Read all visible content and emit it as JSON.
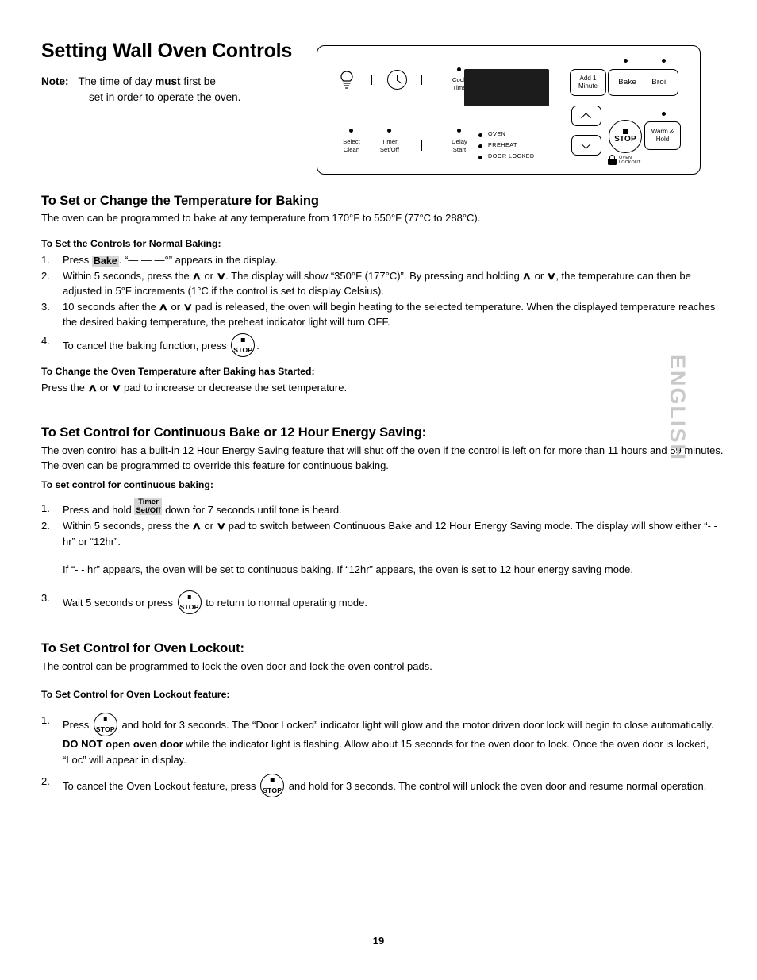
{
  "document": {
    "title": "Setting Wall Oven Controls",
    "page_number": "19",
    "side_tab": "ENGLISH"
  },
  "note": {
    "label": "Note:",
    "line1_part1": "The time of day ",
    "line1_bold": "must",
    "line1_part2": " first be",
    "line2": "set in order to operate the oven."
  },
  "control_panel": {
    "left_group": {
      "bulb_icon": "light-bulb-icon",
      "clock_icon": "clock-icon",
      "cook_time": "Cook\nTime",
      "select_clean": "Select\nClean",
      "timer_set_off": "Timer\nSet/Off",
      "delay_start": "Delay\nStart"
    },
    "indicators": [
      "OVEN",
      "PREHEAT",
      "DOOR LOCKED"
    ],
    "right_group": {
      "add_1_minute": "Add 1\nMinute",
      "bake": "Bake",
      "broil": "Broil",
      "up_arrow": "chevron-up-icon",
      "down_arrow": "chevron-down-icon",
      "stop": "STOP",
      "warm_hold": "Warm &\nHold",
      "oven_lockout": "OVEN\nLOCKOUT"
    }
  },
  "section_baking": {
    "title": "To Set or Change the Temperature for Baking",
    "intro": "The oven can be programmed to bake at any temperature from 170°F to 550°F (77°C to 288°C).",
    "sub_title": "To Set the Controls for Normal Baking:",
    "step1_pre": "Press ",
    "step1_key": "Bake",
    "step1_post": ". “— — —°” appears in the display.",
    "step2_a": "Within 5 seconds, press the ",
    "step2_b": " or ",
    "step2_c": ". The display will show “350°F (177°C)”. By pressing and holding ",
    "step2_d": " or ",
    "step2_e": ", the temperature can then be adjusted in 5°F increments (1°C if the control is set to display Celsius).",
    "step3_a": "10 seconds after the ",
    "step3_b": " or ",
    "step3_c": " pad is released, the oven will begin heating to the selected temperature. When the displayed temperature reaches the desired baking temperature, the preheat indicator light will turn OFF.",
    "step4_pre": "To cancel the baking function, press ",
    "step4_post": ".",
    "change_sub_title": "To Change the Oven Temperature after Baking has Started:",
    "change_a": "Press the ",
    "change_b": " or ",
    "change_c": " pad to increase or decrease the set temperature."
  },
  "section_continuous": {
    "title": "To Set Control for Continuous Bake or 12 Hour Energy Saving:",
    "intro": "The oven control has a built-in 12 Hour Energy Saving feature that will shut off the oven if the control is left on for more than 11 hours and 59 minutes. The oven can be programmed to override this feature for continuous baking.",
    "sub_title": "To set control for continuous baking:",
    "step1_pre": "Press and hold ",
    "step1_key": "Timer\nSet/Off",
    "step1_post": " down for 7 seconds until tone is heard.",
    "step2_a": "Within 5 seconds, press the ",
    "step2_b": " or ",
    "step2_c": " pad to switch between Continuous Bake and 12 Hour Energy Saving mode. The display will show either “- - hr” or “12hr”.",
    "step2_note": "If “- - hr” appears, the oven will be set to continuous baking. If “12hr” appears, the oven is set to 12 hour energy saving mode.",
    "step3_pre": "Wait 5 seconds or press ",
    "step3_post": " to return to normal operating mode."
  },
  "section_lockout": {
    "title": "To Set Control for Oven Lockout:",
    "intro": "The control can be programmed to lock the oven door and lock the oven control pads.",
    "sub_title": "To Set Control for Oven Lockout feature:",
    "step1_pre": "Press ",
    "step1_mid": " and hold for 3 seconds. The “Door Locked” indicator light will glow and the motor driven door lock will begin to close automatically. ",
    "step1_bold": "DO NOT open oven door",
    "step1_post": " while the indicator light is flashing. Allow about 15 seconds for the oven door to lock. Once the oven door is locked, “Loc” will appear in display.",
    "step2_pre": "To cancel the Oven Lockout feature, press ",
    "step2_post": " and hold for 3 seconds. The control will unlock the oven door and resume normal operation."
  },
  "numbers": {
    "n1": "1.",
    "n2": "2.",
    "n3": "3.",
    "n4": "4."
  },
  "glyphs": {
    "up": "∧",
    "down": "∨"
  }
}
